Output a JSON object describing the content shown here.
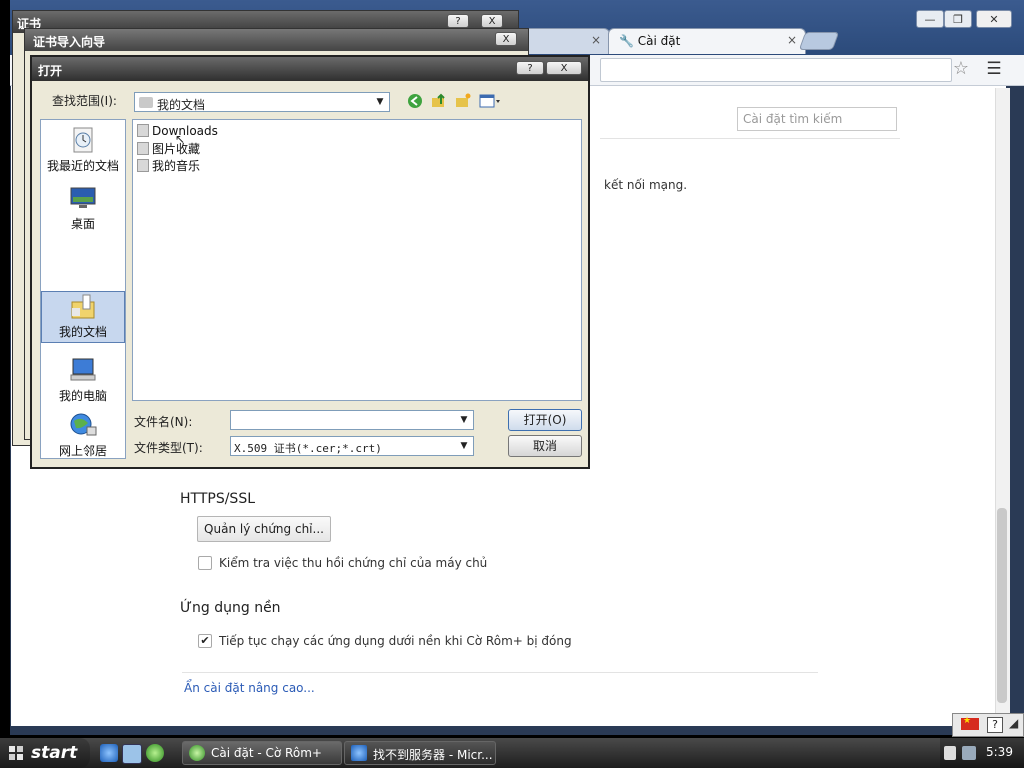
{
  "browser": {
    "tabs": [
      {
        "label": "Cài đặt",
        "close": "×"
      }
    ],
    "hidden_tab_close": "×",
    "window_controls": {
      "minimize": "—",
      "restore": "❐",
      "close": "✕"
    },
    "star_icon": "star-icon",
    "menu_icon": "menu-icon"
  },
  "settings": {
    "search_placeholder": "Cài đặt tìm kiếm",
    "network_text_fragment": "kết nối mạng.",
    "https_title": "HTTPS/SSL",
    "cert_button": "Quản lý chứng chỉ...",
    "revoke_label": "Kiểm tra việc thu hồi chứng chỉ của máy chủ",
    "revoke_checked": false,
    "bgapps_title": "Ứng dụng nền",
    "bgapps_label": "Tiếp tục chạy các ứng dụng dưới nền khi Cờ Rôm+ bị đóng",
    "bgapps_checked": true,
    "advanced_link": "Ẩn cài đặt nâng cao..."
  },
  "cert_dialog": {
    "title": "证书",
    "help": "?",
    "close": "X"
  },
  "wizard_dialog": {
    "title": "证书导入向导",
    "close": "X"
  },
  "open_dialog": {
    "title": "打开",
    "help": "?",
    "close": "X",
    "lookin_label": "查找范围(I):",
    "lookin_value": "我的文档",
    "places": [
      {
        "label": "我最近的文档",
        "icon": "recent-documents-icon"
      },
      {
        "label": "桌面",
        "icon": "desktop-icon"
      },
      {
        "label": "我的文档",
        "icon": "my-documents-icon"
      },
      {
        "label": "我的电脑",
        "icon": "my-computer-icon"
      },
      {
        "label": "网上邻居",
        "icon": "network-places-icon"
      }
    ],
    "files": [
      "Downloads",
      "图片收藏",
      "我的音乐"
    ],
    "filename_label": "文件名(N):",
    "filename_value": "",
    "filetype_label": "文件类型(T):",
    "filetype_value": "X.509 证书(*.cer;*.crt)",
    "open_button": "打开(O)",
    "cancel_button": "取消"
  },
  "taskbar": {
    "start_label": "start",
    "tasks": [
      {
        "label": "Cài đặt - Cờ Rôm+"
      },
      {
        "label": "找不到服务器 - Micr..."
      }
    ],
    "clock": "5:39",
    "lang_help": "?"
  },
  "colors": {
    "link": "#2b5bb6",
    "selected_place": "#c7d7ee",
    "taskbar": "#2e2e2e"
  }
}
